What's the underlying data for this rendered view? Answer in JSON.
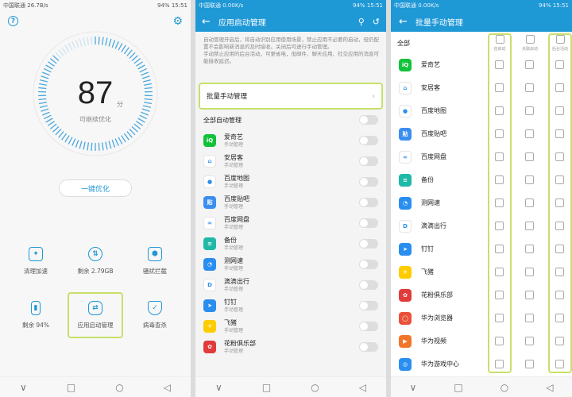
{
  "status": {
    "carrier": "中国联通",
    "net1": "26.7B/s",
    "net2": "0.00K/s",
    "battery": "94%",
    "time": "15:51"
  },
  "screen1": {
    "score": "87",
    "score_unit": "分",
    "score_caption": "可继续优化",
    "optimize_label": "一键优化",
    "tools": [
      {
        "label": "清理加速",
        "icon": "broom-icon"
      },
      {
        "label": "剩余 2.79GB",
        "icon": "data-icon"
      },
      {
        "label": "骚扰拦截",
        "icon": "shield-block-icon"
      },
      {
        "label": "剩余 94%",
        "icon": "battery-icon"
      },
      {
        "label": "应用启动管理",
        "icon": "toggle-icon"
      },
      {
        "label": "病毒查杀",
        "icon": "virus-shield-icon"
      }
    ]
  },
  "screen2": {
    "title": "应用启动管理",
    "desc1": "自动管理开启后，将自动识别应用使用场景，禁止应用不必要的启动，但仍配置不会影响新消息的及时接收。关闭后可进行手动管理。",
    "desc2": "手动禁止应用的后台活动，可更省电，但邮件、聊天应用、社交应用的消息可能接收延迟。",
    "batch_label": "批量手动管理",
    "all_auto_label": "全部自动管理",
    "sub_label": "手动管理",
    "apps": [
      {
        "name": "爱奇艺",
        "color": "#12c23a",
        "glyph": "iQ"
      },
      {
        "name": "安居客",
        "color": "#ffffff",
        "glyph": "⌂"
      },
      {
        "name": "百度地图",
        "color": "#ffffff",
        "glyph": "●"
      },
      {
        "name": "百度贴吧",
        "color": "#3b8ef0",
        "glyph": "贴"
      },
      {
        "name": "百度网盘",
        "color": "#ffffff",
        "glyph": "∞"
      },
      {
        "name": "备份",
        "color": "#1fb9a7",
        "glyph": "≡"
      },
      {
        "name": "测网速",
        "color": "#2a8ef0",
        "glyph": "◔"
      },
      {
        "name": "滴滴出行",
        "color": "#ffffff",
        "glyph": "D"
      },
      {
        "name": "钉钉",
        "color": "#2a8ef0",
        "glyph": "➤"
      },
      {
        "name": "飞猪",
        "color": "#ffcc00",
        "glyph": "✈"
      },
      {
        "name": "花粉俱乐部",
        "color": "#e23b3b",
        "glyph": "✿"
      }
    ]
  },
  "screen3": {
    "title": "批量手动管理",
    "all_label": "全部",
    "col_labels": [
      "自启动",
      "关联启动",
      "后台活动"
    ],
    "apps": [
      {
        "name": "爱奇艺",
        "color": "#12c23a",
        "glyph": "iQ"
      },
      {
        "name": "安居客",
        "color": "#ffffff",
        "glyph": "⌂"
      },
      {
        "name": "百度地图",
        "color": "#ffffff",
        "glyph": "●"
      },
      {
        "name": "百度贴吧",
        "color": "#3b8ef0",
        "glyph": "贴"
      },
      {
        "name": "百度网盘",
        "color": "#ffffff",
        "glyph": "∞"
      },
      {
        "name": "备份",
        "color": "#1fb9a7",
        "glyph": "≡"
      },
      {
        "name": "测网速",
        "color": "#2a8ef0",
        "glyph": "◔"
      },
      {
        "name": "滴滴出行",
        "color": "#ffffff",
        "glyph": "D"
      },
      {
        "name": "钉钉",
        "color": "#2a8ef0",
        "glyph": "➤"
      },
      {
        "name": "飞猪",
        "color": "#ffcc00",
        "glyph": "✈"
      },
      {
        "name": "花粉俱乐部",
        "color": "#e23b3b",
        "glyph": "✿"
      },
      {
        "name": "华为浏览器",
        "color": "#e8523a",
        "glyph": "◯"
      },
      {
        "name": "华为视频",
        "color": "#f2762a",
        "glyph": "▶"
      },
      {
        "name": "华为游戏中心",
        "color": "#2a8ef0",
        "glyph": "◎"
      }
    ]
  },
  "nav": {
    "back": "∨",
    "home": "□",
    "recent": "○",
    "triangle": "◁"
  }
}
